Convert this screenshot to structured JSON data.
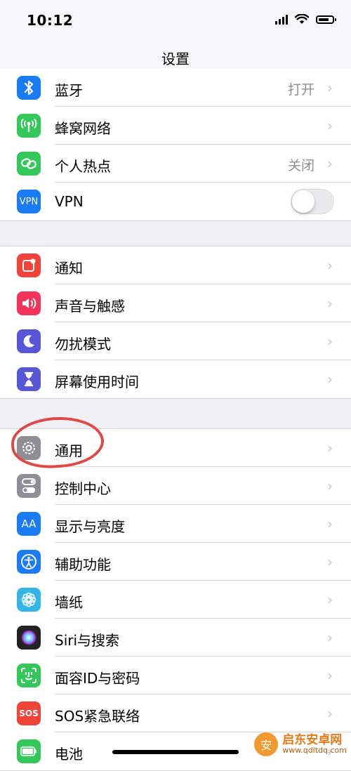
{
  "status_bar": {
    "time": "10:12"
  },
  "nav": {
    "title": "设置"
  },
  "groups": [
    {
      "rows": [
        {
          "label": "蓝牙",
          "value": "打开",
          "icon": "bluetooth-icon",
          "icon_color": "#1a7cf5",
          "chevron": "›"
        },
        {
          "label": "蜂窝网络",
          "value": "",
          "icon": "cellular-antenna-icon",
          "icon_color": "#34c759",
          "chevron": "›"
        },
        {
          "label": "个人热点",
          "value": "关闭",
          "icon": "hotspot-link-icon",
          "icon_color": "#34c759",
          "chevron": "›"
        },
        {
          "label": "VPN",
          "icon": "vpn-icon",
          "icon_text": "VPN",
          "icon_color": "#1a7cf5",
          "toggle_on": false
        }
      ]
    },
    {
      "rows": [
        {
          "label": "通知",
          "icon": "notifications-icon",
          "icon_color": "#f2433a",
          "chevron": "›"
        },
        {
          "label": "声音与触感",
          "icon": "speaker-icon",
          "icon_color": "#f2345a",
          "chevron": "›"
        },
        {
          "label": "勿扰模式",
          "icon": "moon-icon",
          "icon_color": "#5856d6",
          "chevron": "›"
        },
        {
          "label": "屏幕使用时间",
          "icon": "hourglass-icon",
          "icon_color": "#5856d6",
          "chevron": "›"
        }
      ]
    },
    {
      "rows": [
        {
          "label": "通用",
          "icon": "gear-icon",
          "icon_color": "#8e8e93",
          "chevron": "›"
        },
        {
          "label": "控制中心",
          "icon": "toggles-icon",
          "icon_color": "#8e8e93",
          "chevron": "›"
        },
        {
          "label": "显示与亮度",
          "icon": "display-text-size-icon",
          "icon_text": "AA",
          "icon_color": "#1a7cf5",
          "chevron": "›"
        },
        {
          "label": "辅助功能",
          "icon": "accessibility-icon",
          "icon_color": "#1a7cf5",
          "chevron": "›"
        },
        {
          "label": "墙纸",
          "icon": "wallpaper-flower-icon",
          "icon_color": "#33b6e5",
          "chevron": "›"
        },
        {
          "label": "Siri与搜索",
          "icon": "siri-icon",
          "icon_color": "#222222",
          "chevron": "›"
        },
        {
          "label": "面容ID与密码",
          "icon": "face-id-icon",
          "icon_color": "#34c759",
          "chevron": "›"
        },
        {
          "label": "SOS紧急联络",
          "icon": "sos-icon",
          "icon_text": "SOS",
          "icon_color": "#f2433a",
          "chevron": "›"
        },
        {
          "label": "电池",
          "icon": "battery-icon",
          "icon_color": "#34c759",
          "chevron": "›"
        }
      ]
    }
  ],
  "annotation": {
    "circled_item": "通用",
    "color": "#e04848"
  },
  "status_icons": {
    "battery_level": 0.8
  },
  "watermark": {
    "logo_text": "安",
    "title": "启东安卓网",
    "url": "www.qdltdq.com"
  }
}
